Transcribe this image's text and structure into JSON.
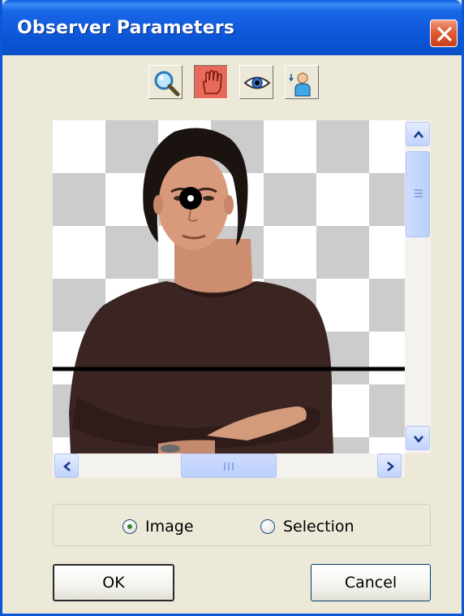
{
  "window": {
    "title": "Observer Parameters"
  },
  "toolbar": {
    "tools": [
      {
        "icon": "magnifier-icon",
        "active": false
      },
      {
        "icon": "hand-icon",
        "active": true
      },
      {
        "icon": "eye-icon",
        "active": false
      },
      {
        "icon": "observer-person-icon",
        "active": false
      }
    ]
  },
  "viewport": {
    "content": "photo of man with arms crossed on transparency checkerboard",
    "has_eye_marker": true,
    "has_horizon_line": true
  },
  "options": {
    "radios": [
      {
        "label": "Image",
        "checked": true
      },
      {
        "label": "Selection",
        "checked": false
      }
    ]
  },
  "buttons": {
    "ok_label": "OK",
    "cancel_label": "Cancel"
  },
  "colors": {
    "titlebar": "#0b55d6",
    "close": "#e2582e",
    "active_tool": "#e86a5a",
    "face": "#ece9d8"
  }
}
